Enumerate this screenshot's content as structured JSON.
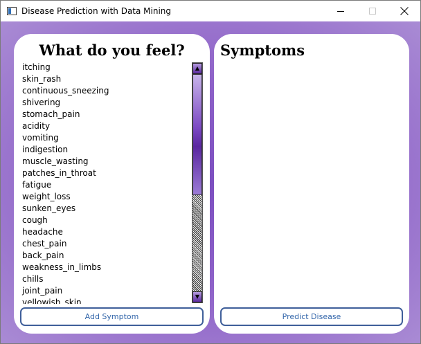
{
  "window": {
    "title": "Disease Prediction with Data Mining",
    "controls": {
      "minimize": "minimize-icon",
      "maximize": "maximize-icon",
      "close": "close-icon"
    }
  },
  "left_panel": {
    "heading": "What do you feel?",
    "symptoms": [
      "itching",
      "skin_rash",
      "continuous_sneezing",
      "shivering",
      "stomach_pain",
      "acidity",
      "vomiting",
      "indigestion",
      "muscle_wasting",
      "patches_in_throat",
      "fatigue",
      "weight_loss",
      "sunken_eyes",
      "cough",
      "headache",
      "chest_pain",
      "back_pain",
      "weakness_in_limbs",
      "chills",
      "joint_pain",
      "yellowish_skin"
    ],
    "add_button": "Add Symptom"
  },
  "right_panel": {
    "heading": "Symptoms",
    "predict_button": "Predict Disease"
  },
  "colors": {
    "background_center": "#7c4fc0",
    "background_edge": "#a98bd4",
    "button_border": "#3f5f9a",
    "button_text": "#3366aa"
  }
}
